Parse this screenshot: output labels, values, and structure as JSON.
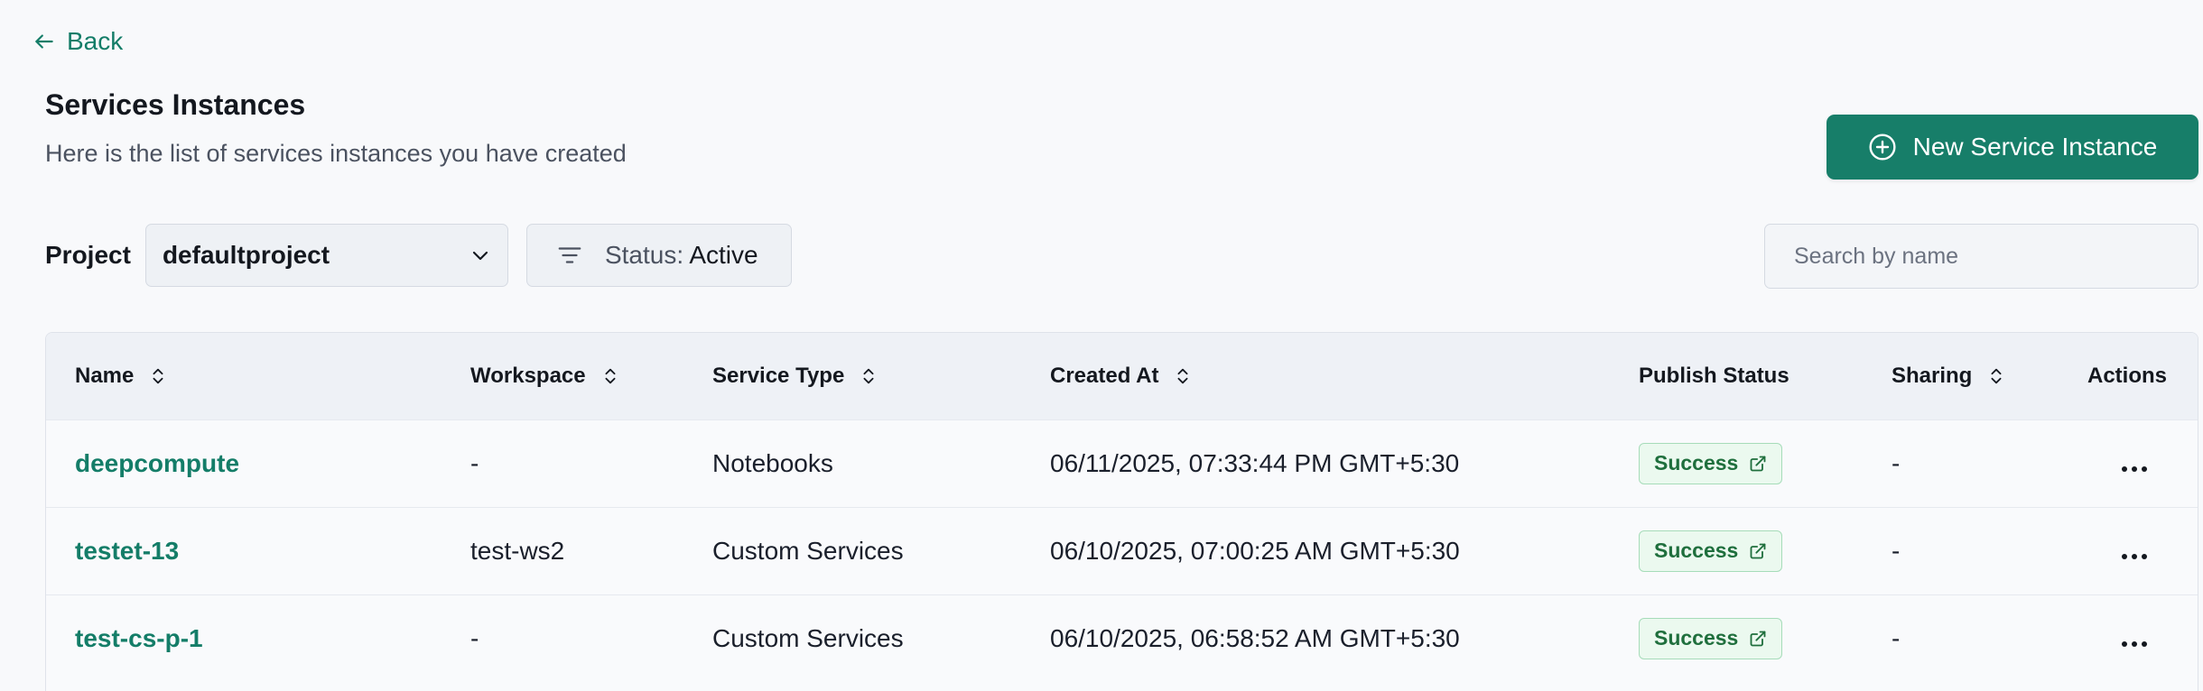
{
  "nav": {
    "back_label": "Back"
  },
  "header": {
    "title": "Services Instances",
    "subtitle": "Here is the list of services instances you have created",
    "new_button_label": "New Service Instance"
  },
  "filters": {
    "project_label": "Project",
    "project_value": "defaultproject",
    "status_key": "Status:",
    "status_value": "Active",
    "search_placeholder": "Search by name"
  },
  "table": {
    "columns": [
      "Name",
      "Workspace",
      "Service Type",
      "Created At",
      "Publish Status",
      "Sharing",
      "Actions"
    ],
    "rows": [
      {
        "name": "deepcompute",
        "workspace": "-",
        "service_type": "Notebooks",
        "created_at": "06/11/2025, 07:33:44 PM GMT+5:30",
        "publish_status": "Success",
        "sharing": "-"
      },
      {
        "name": "testet-13",
        "workspace": "test-ws2",
        "service_type": "Custom Services",
        "created_at": "06/10/2025, 07:00:25 AM GMT+5:30",
        "publish_status": "Success",
        "sharing": "-"
      },
      {
        "name": "test-cs-p-1",
        "workspace": "-",
        "service_type": "Custom Services",
        "created_at": "06/10/2025, 06:58:52 AM GMT+5:30",
        "publish_status": "Success",
        "sharing": "-"
      }
    ]
  },
  "colors": {
    "accent": "#177e69",
    "link": "#147d68",
    "success_bg": "#ebf9ef",
    "success_text": "#1f6f3d"
  },
  "icons": {
    "back": "arrow-left-icon",
    "new": "plus-circle-icon",
    "dropdown": "chevron-down-icon",
    "filter": "filter-icon",
    "sort": "sort-icon",
    "external": "external-link-icon",
    "actions": "more-horizontal-icon"
  }
}
